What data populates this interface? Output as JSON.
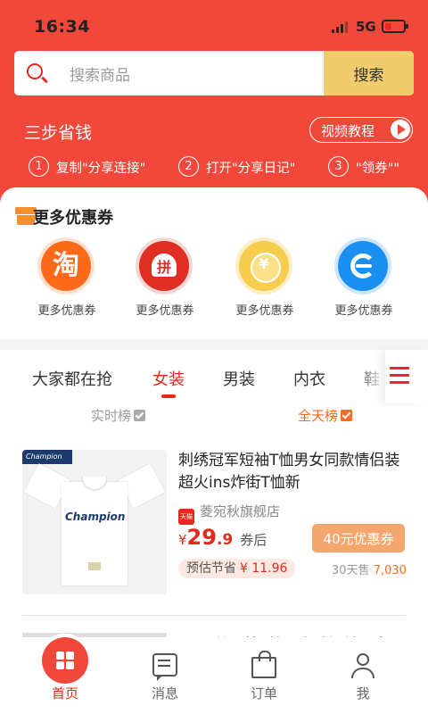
{
  "status_bar": {
    "time": "16:34",
    "network": "5G"
  },
  "search": {
    "placeholder": "搜索商品",
    "button_label": "搜索"
  },
  "steps": {
    "title": "三步省钱",
    "video_label": "视频教程",
    "items": [
      {
        "num": "1",
        "text": "复制\"分享连接\""
      },
      {
        "num": "2",
        "text": "打开\"分享日记\""
      },
      {
        "num": "3",
        "text": "\"领券\"\""
      }
    ]
  },
  "coupons": {
    "title": "更多优惠券",
    "platforms": [
      {
        "icon": "taobao-icon",
        "glyph": "淘",
        "label": "更多优惠券"
      },
      {
        "icon": "pinduoduo-icon",
        "label": "更多优惠券"
      },
      {
        "icon": "coupon-coin-icon",
        "label": "更多优惠券"
      },
      {
        "icon": "eleme-icon",
        "label": "更多优惠券"
      }
    ]
  },
  "tabs": {
    "items": [
      "大家都在抢",
      "女装",
      "男装",
      "内衣",
      "鞋"
    ],
    "active": "女装"
  },
  "rank_filters": [
    {
      "label": "实时榜",
      "checked": true,
      "active": false
    },
    {
      "label": "全天榜",
      "checked": true,
      "active": true
    }
  ],
  "products": [
    {
      "brand_tag": "Champion",
      "image_logo": "Champion",
      "title": "刺绣冠军短袖T恤男女同款情侣装超火ins炸街T恤新",
      "store_badge": "天猫",
      "store": "菱宛秋旗舰店",
      "currency": "¥",
      "price_int": "29",
      "price_dec": ".9",
      "price_suffix": "券后",
      "coupon_label": "40元优惠券",
      "save_label": "预估节省",
      "save_amount": "¥ 11.96",
      "sold_label": "30天售",
      "sold_count": "7,030"
    },
    {
      "title": "GMC丝柔棉T恤 | 亲肤短袖男女同"
    }
  ],
  "bottom_nav": [
    {
      "label": "首页",
      "icon": "home-icon",
      "active": true
    },
    {
      "label": "消息",
      "icon": "message-icon",
      "active": false
    },
    {
      "label": "订单",
      "icon": "shopping-bag-icon",
      "active": false
    },
    {
      "label": "我",
      "icon": "user-icon",
      "active": false
    }
  ],
  "colors": {
    "brand_red": "#f2483b",
    "search_button": "#f0cc6b",
    "accent_orange": "#ff6a1a"
  }
}
